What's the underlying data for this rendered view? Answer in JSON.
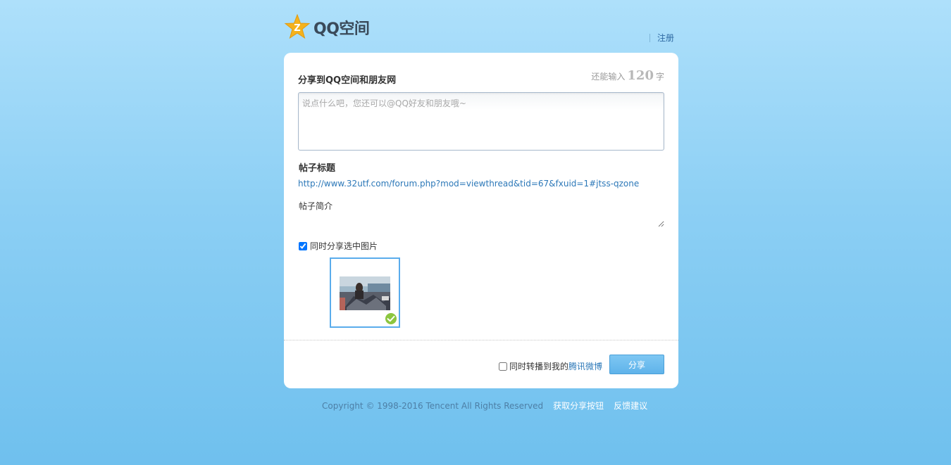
{
  "header": {
    "logo_text": "QQ空间",
    "register_label": "注册"
  },
  "share": {
    "title": "分享到QQ空间和朋友网",
    "counter_prefix": "还能输入",
    "counter_value": "120",
    "counter_suffix": "字",
    "comment_placeholder": "说点什么吧，您还可以@QQ好友和朋友哦~",
    "comment_value": ""
  },
  "post": {
    "title": "帖子标题",
    "url": "http://www.32utf.com/forum.php?mod=viewthread&tid=67&fxuid=1#jtss-qzone",
    "summary_label": "帖子简介",
    "summary_value": ""
  },
  "image_share": {
    "checkbox_label": "同时分享选中图片",
    "checked": true,
    "thumbnail_selected": true
  },
  "weibo": {
    "checkbox_label": "同时转播到我的",
    "link_label": "腾讯微博",
    "checked": false
  },
  "actions": {
    "share_button_label": "分享"
  },
  "footer": {
    "copyright": "Copyright © 1998-2016 Tencent All Rights Reserved",
    "get_button_link": "获取分享按钮",
    "feedback_link": "反馈建议"
  },
  "colors": {
    "background_top": "#aee0fb",
    "background_bottom": "#6fc0ee",
    "link_blue": "#2c78b8",
    "button_blue": "#5fb3ea",
    "thumb_border": "#5aacec",
    "check_green": "#8cc63f",
    "logo_star": "#f5b21c"
  }
}
